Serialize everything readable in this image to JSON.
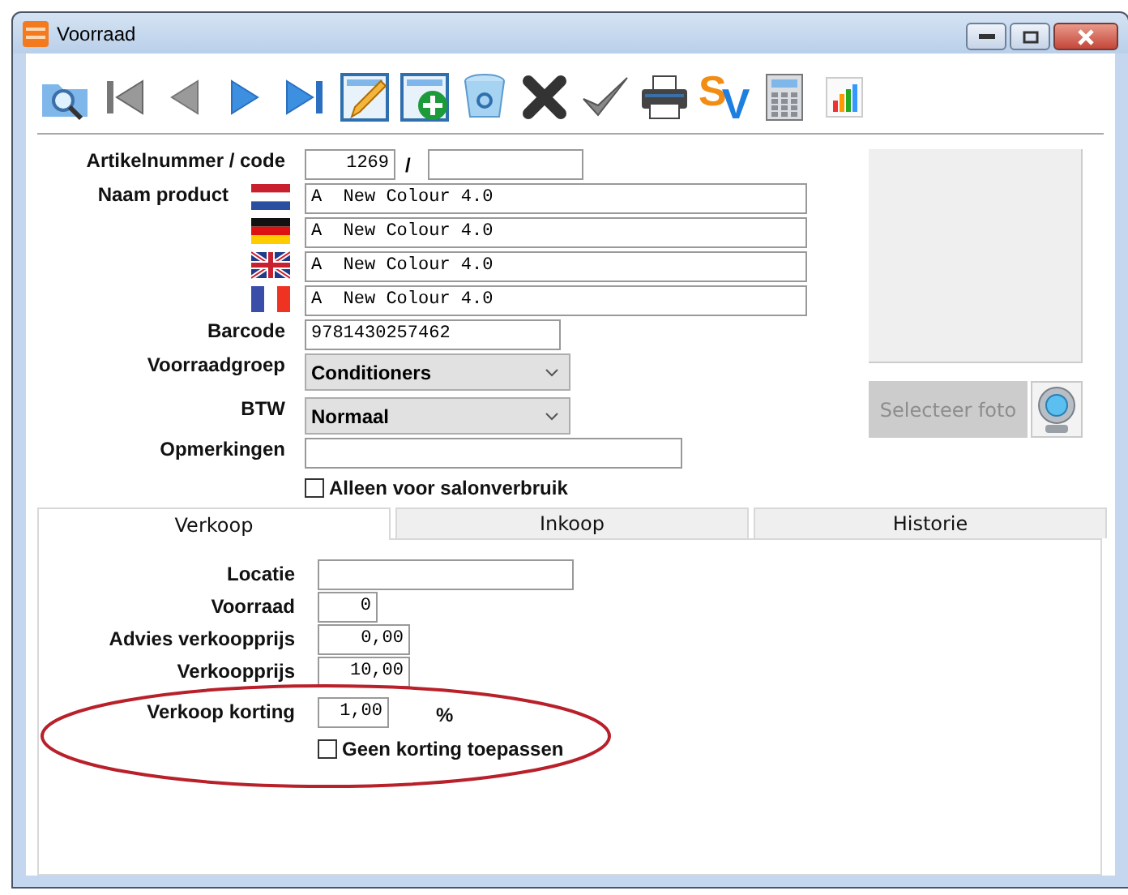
{
  "window": {
    "title": "Voorraad"
  },
  "toolbar": {
    "brand": "SV"
  },
  "article": {
    "label": "Artikelnummer / code",
    "number": "1269",
    "separator": "/"
  },
  "product_names": {
    "label": "Naam product",
    "rows": [
      {
        "kind": "dutch",
        "value": "A  New Colour 4.0"
      },
      {
        "kind": "german",
        "value": "A  New Colour 4.0"
      },
      {
        "kind": "british",
        "value": "A  New Colour 4.0"
      },
      {
        "kind": "french",
        "value": "A  New Colour 4.0"
      }
    ]
  },
  "barcode": {
    "label": "Barcode",
    "value": "9781430257462"
  },
  "stock_group": {
    "label": "Voorraadgroep",
    "value": "Conditioners"
  },
  "vat": {
    "label": "BTW",
    "value": "Normaal"
  },
  "remarks": {
    "label": "Opmerkingen"
  },
  "salon_only": {
    "label": "Alleen voor salonverbruik",
    "checked": false
  },
  "photo": {
    "button": "Selecteer foto",
    "disabled": true
  },
  "tabs": [
    {
      "label": "Verkoop",
      "selected": true
    },
    {
      "label": "Inkoop",
      "selected": false
    },
    {
      "label": "Historie",
      "selected": false
    }
  ],
  "sales": {
    "fields": [
      {
        "label": "Locatie"
      },
      {
        "label": "Voorraad",
        "value": "0"
      },
      {
        "label": "Advies verkoopprijs",
        "value": "0,00"
      },
      {
        "label": "Verkoopprijs",
        "value": "10,00"
      },
      {
        "label": "Verkoop korting",
        "value": "1,00",
        "unit": "%"
      }
    ],
    "no_discount": {
      "label": "Geen korting toepassen",
      "checked": false
    }
  }
}
